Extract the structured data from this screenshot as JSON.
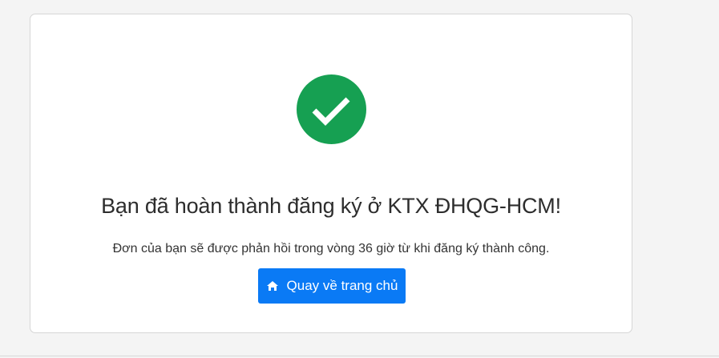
{
  "success": {
    "icon": "check-circle-icon",
    "icon_color": "#16a052",
    "title": "Bạn đã hoàn thành đăng ký ở KTX ĐHQG-HCM!",
    "message": "Đơn của bạn sẽ được phản hồi trong vòng 36 giờ từ khi đăng ký thành công."
  },
  "actions": {
    "home_button_label": "Quay về trang chủ",
    "home_button_icon": "home-icon",
    "home_button_color": "#0a7af5"
  }
}
